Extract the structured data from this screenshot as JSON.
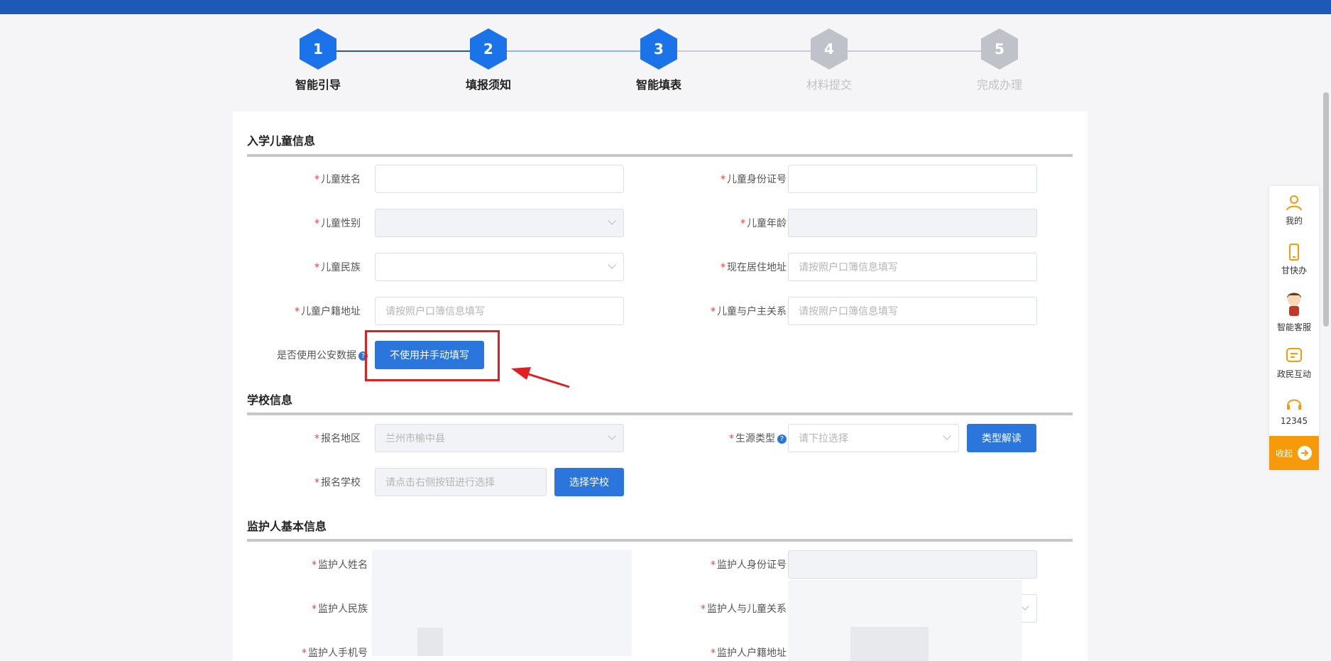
{
  "steps": [
    {
      "num": "1",
      "label": "智能引导",
      "active": true
    },
    {
      "num": "2",
      "label": "填报须知",
      "active": true
    },
    {
      "num": "3",
      "label": "智能填表",
      "active": true
    },
    {
      "num": "4",
      "label": "材料提交",
      "active": false
    },
    {
      "num": "5",
      "label": "完成办理",
      "active": false
    }
  ],
  "colors": {
    "active": "#1a73e8",
    "inactive": "#bfc3c9",
    "accent": "#2a76dd",
    "highlight": "#e02020",
    "orange": "#f59b0a"
  },
  "child": {
    "title": "入学儿童信息",
    "name_label": "儿童姓名",
    "id_label": "儿童身份证号",
    "gender_label": "儿童性别",
    "age_label": "儿童年龄",
    "nation_label": "儿童民族",
    "address_label": "现在居住地址",
    "address_placeholder": "请按照户口簿信息填写",
    "huji_label": "儿童户籍地址",
    "huji_placeholder": "请按照户口簿信息填写",
    "relation_label": "儿童与户主关系",
    "relation_placeholder": "请按照户口簿信息填写",
    "police_label": "是否使用公安数据",
    "police_button": "不使用并手动填写"
  },
  "school": {
    "title": "学校信息",
    "region_label": "报名地区",
    "region_value": "兰州市榆中县",
    "source_label": "生源类型",
    "source_placeholder": "请下拉选择",
    "type_button": "类型解读",
    "school_label": "报名学校",
    "school_placeholder": "请点击右侧按钮进行选择",
    "select_button": "选择学校"
  },
  "guardian": {
    "title": "监护人基本信息",
    "name_label": "监护人姓名",
    "id_label": "监护人身份证号",
    "nation_label": "监护人民族",
    "relation_label": "监护人与儿童关系",
    "phone_label": "监护人手机号",
    "huji_label": "监护人户籍地址"
  },
  "sidebar": {
    "items": [
      {
        "label": "我的",
        "icon": "user-icon"
      },
      {
        "label": "甘快办",
        "icon": "phone-icon"
      },
      {
        "label": "智能客服",
        "icon": "assistant-avatar-icon"
      },
      {
        "label": "政民互动",
        "icon": "message-icon"
      },
      {
        "label": "12345",
        "icon": "headset-icon"
      }
    ],
    "collapse_label": "收起"
  }
}
